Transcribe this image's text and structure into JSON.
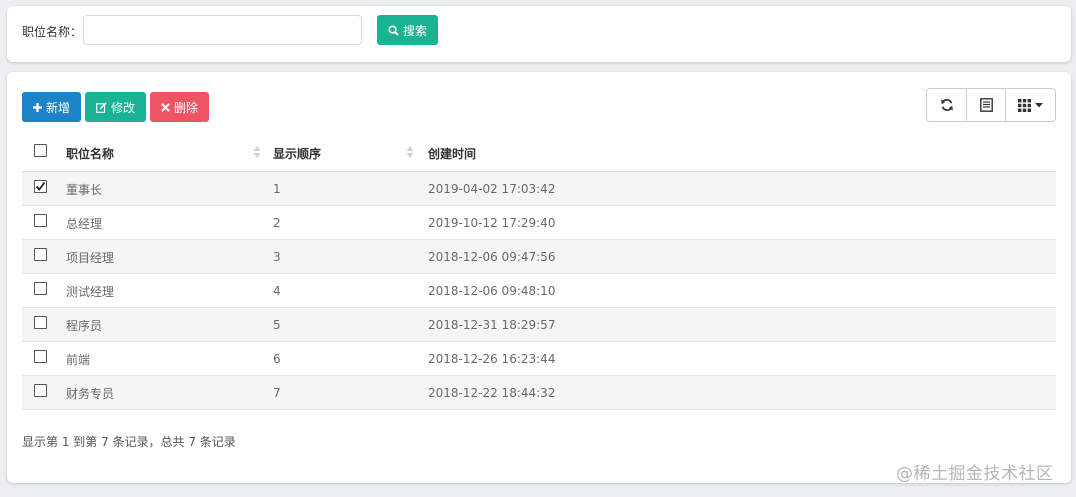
{
  "search": {
    "label": "职位名称：",
    "input_value": "",
    "input_placeholder": "",
    "button_label": "搜索"
  },
  "toolbar": {
    "add_label": "新增",
    "edit_label": "修改",
    "delete_label": "删除"
  },
  "colors": {
    "primary": "#1c84c6",
    "success": "#1ab394",
    "danger": "#ed5565"
  },
  "table": {
    "columns": [
      "职位名称",
      "显示顺序",
      "创建时间"
    ],
    "rows": [
      {
        "name": "董事长",
        "order": "1",
        "created": "2019-04-02 17:03:42",
        "checked": true
      },
      {
        "name": "总经理",
        "order": "2",
        "created": "2019-10-12 17:29:40",
        "checked": false
      },
      {
        "name": "项目经理",
        "order": "3",
        "created": "2018-12-06 09:47:56",
        "checked": false
      },
      {
        "name": "测试经理",
        "order": "4",
        "created": "2018-12-06 09:48:10",
        "checked": false
      },
      {
        "name": "程序员",
        "order": "5",
        "created": "2018-12-31 18:29:57",
        "checked": false
      },
      {
        "name": "前端",
        "order": "6",
        "created": "2018-12-26 16:23:44",
        "checked": false
      },
      {
        "name": "财务专员",
        "order": "7",
        "created": "2018-12-22 18:44:32",
        "checked": false
      }
    ]
  },
  "pagination": {
    "info": "显示第 1 到第 7 条记录，总共 7 条记录"
  },
  "watermark": "@稀土掘金技术社区"
}
